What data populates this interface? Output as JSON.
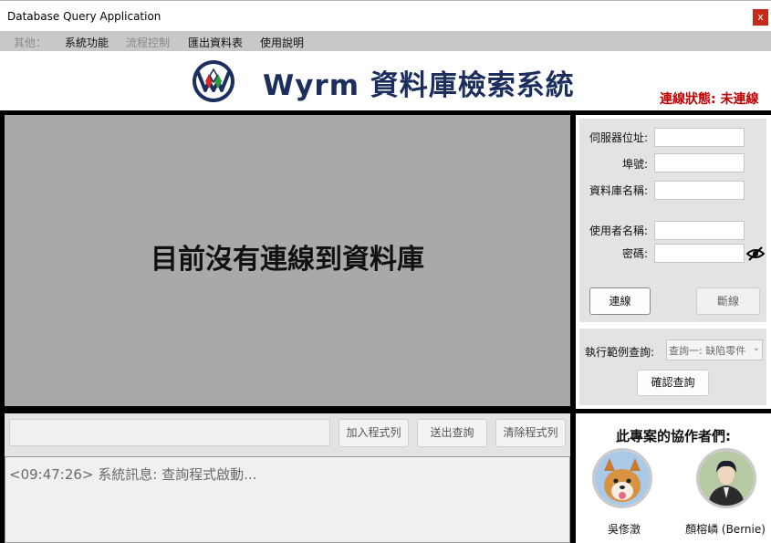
{
  "window": {
    "title": "Database Query Application",
    "close_label": "x"
  },
  "menu": [
    {
      "label": "其他：",
      "enabled": false
    },
    {
      "label": "系統功能",
      "enabled": true
    },
    {
      "label": "流程控制",
      "enabled": false
    },
    {
      "label": "匯出資料表",
      "enabled": true
    },
    {
      "label": "使用說明",
      "enabled": true
    }
  ],
  "header": {
    "app_title": "Wyrm 資料庫檢索系統",
    "connection_status": "連線狀態: 未連線"
  },
  "display": {
    "message": "目前沒有連線到資料庫"
  },
  "connection": {
    "server_label": "伺服器位址:",
    "port_label": "埠號:",
    "dbname_label": "資料庫名稱:",
    "username_label": "使用者名稱:",
    "password_label": "密碼:",
    "server_value": "",
    "port_value": "",
    "dbname_value": "",
    "username_value": "",
    "password_value": "",
    "connect_label": "連線",
    "disconnect_label": "斷線"
  },
  "sample_query": {
    "label": "執行範例查詢:",
    "selected": "查詢一: 缺陷零件",
    "confirm_label": "確認查詢"
  },
  "query": {
    "input_value": "",
    "add_label": "加入程式列",
    "send_label": "送出查詢",
    "clear_label": "清除程式列"
  },
  "log": {
    "line": "<09:47:26> 系統訊息: 查詢程式啟動..."
  },
  "collaborators": {
    "title": "此專案的協作者們:",
    "people": [
      {
        "name": "吳俢澂"
      },
      {
        "name": "顏榕嶙 (Bernie)"
      }
    ]
  },
  "colors": {
    "brand": "#1c2e5e",
    "status": "#c00000",
    "panel": "#e3e3e3",
    "display": "#a9a9a9"
  }
}
